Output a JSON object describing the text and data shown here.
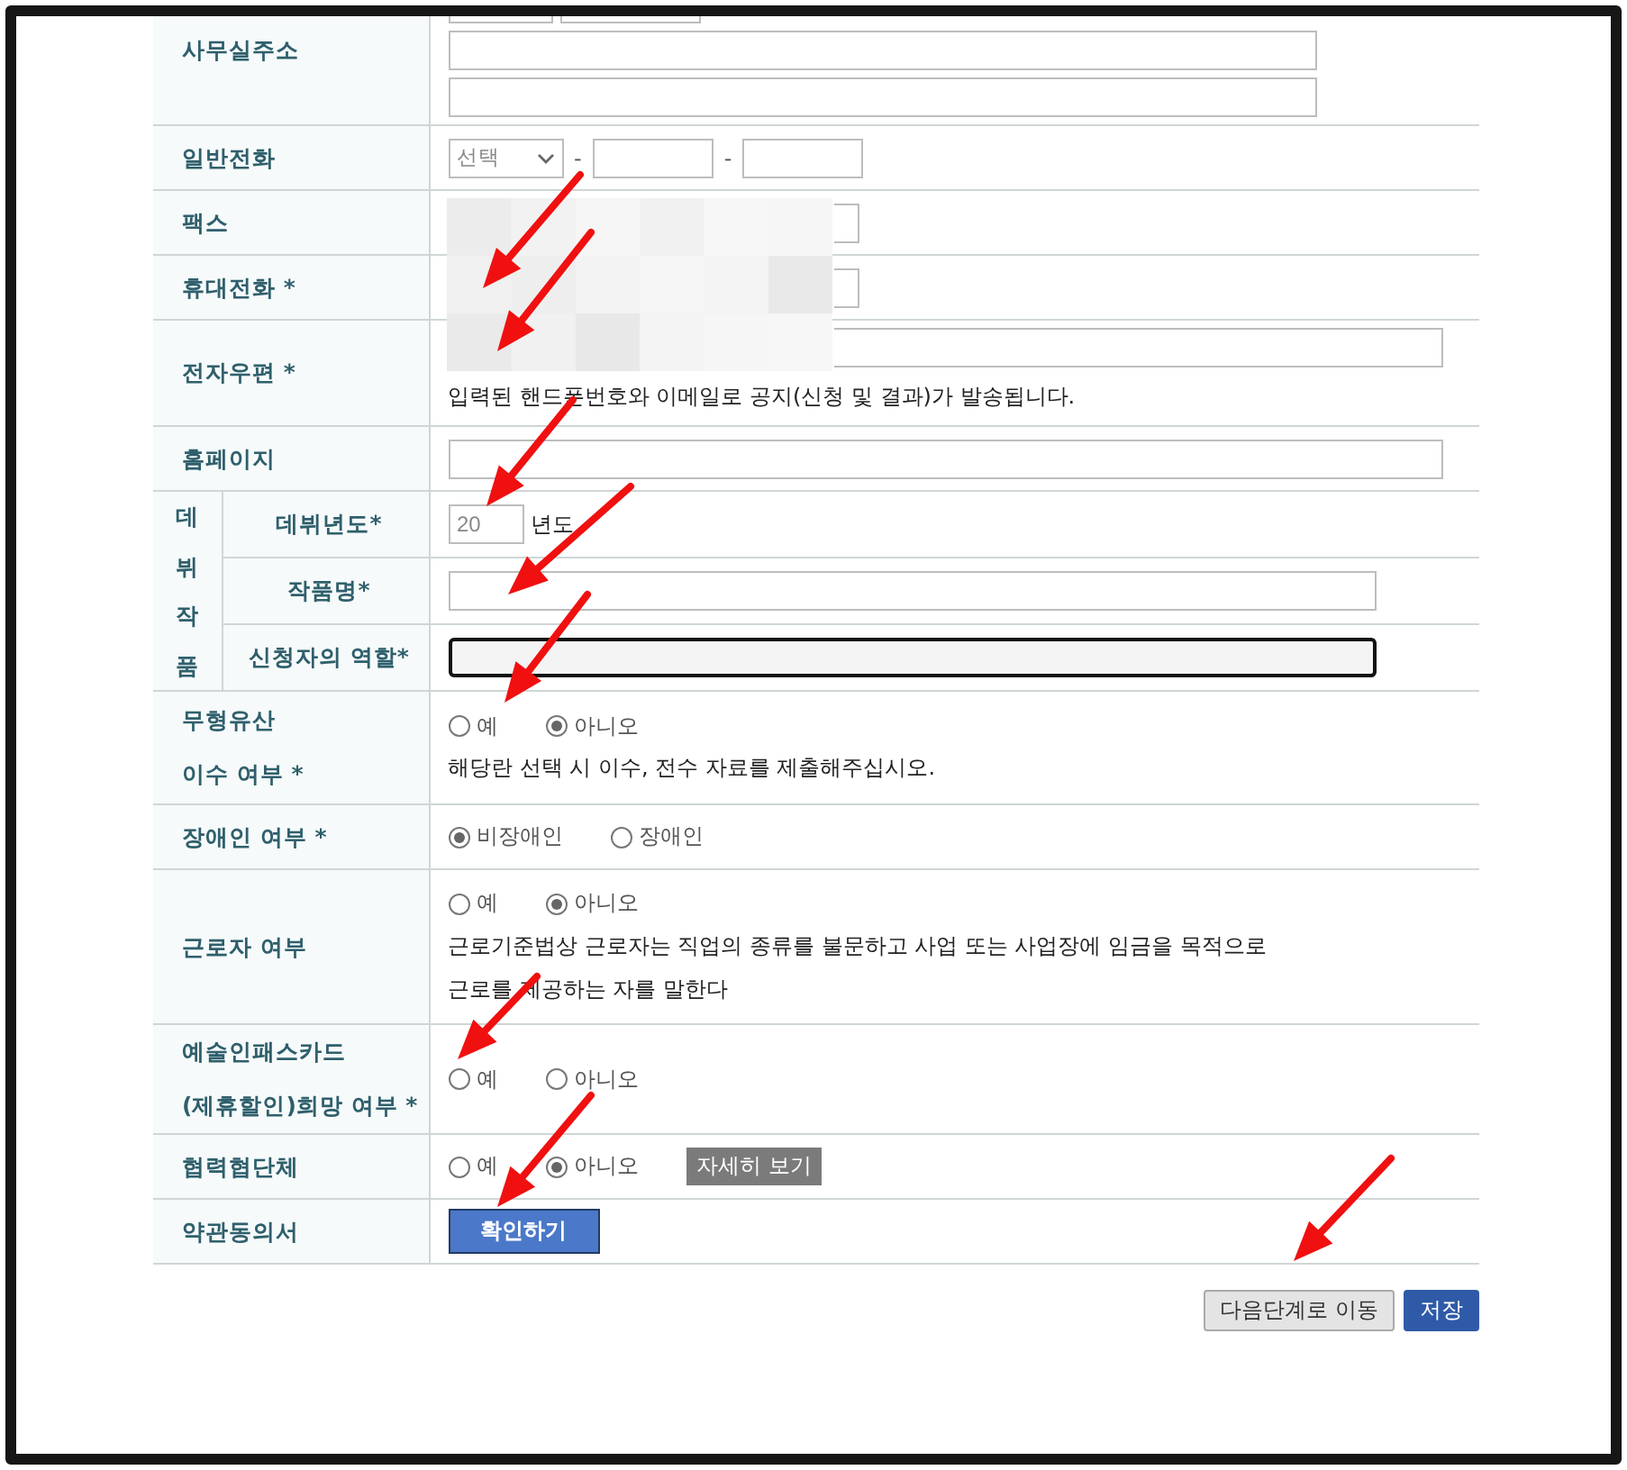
{
  "rows": [
    {
      "kind": "address",
      "label_lines": [
        "사무실주소"
      ]
    },
    {
      "kind": "phone",
      "label_lines": [
        "일반전화"
      ],
      "select": "선택",
      "separators": [
        "-",
        "-"
      ]
    },
    {
      "kind": "phone_hidden",
      "label_lines": [
        "팩스"
      ]
    },
    {
      "kind": "phone_hidden",
      "label_lines": [
        "휴대전화 *"
      ]
    },
    {
      "kind": "email",
      "label_lines": [
        "전자우편 *"
      ],
      "notes": [
        "입력된 핸드폰번호와 이메일로 공지(신청 및 결과)가 발송됩니다."
      ]
    },
    {
      "kind": "text",
      "label_lines": [
        "홈페이지"
      ]
    },
    {
      "kind": "group",
      "label": "데뷔작품",
      "children": [
        {
          "kind": "year",
          "label": "데뷔년도*",
          "value": "20",
          "unit": "년도"
        },
        {
          "kind": "text",
          "label": "작품명*",
          "focused": false
        },
        {
          "kind": "text",
          "label": "신청자의 역할*",
          "focused": true
        }
      ]
    },
    {
      "kind": "radio",
      "label_lines": [
        "무형유산",
        "이수 여부 *"
      ],
      "options": [
        {
          "label": "예",
          "selected": false
        },
        {
          "label": "아니오",
          "selected": true
        }
      ],
      "notes": [
        "해당란 선택 시 이수, 전수 자료를 제출해주십시오."
      ]
    },
    {
      "kind": "radio",
      "label_lines": [
        "장애인 여부 *"
      ],
      "options": [
        {
          "label": "비장애인",
          "selected": true
        },
        {
          "label": "장애인",
          "selected": false
        }
      ]
    },
    {
      "kind": "radio",
      "label_lines": [
        "근로자 여부"
      ],
      "options": [
        {
          "label": "예",
          "selected": false
        },
        {
          "label": "아니오",
          "selected": true
        }
      ],
      "notes": [
        "근로기준법상 근로자는 직업의 종류를 불문하고 사업 또는 사업장에 임금을 목적으로",
        "근로를 제공하는 자를 말한다"
      ]
    },
    {
      "kind": "radio",
      "label_lines": [
        "예술인패스카드",
        "(제휴할인)희망 여부 *"
      ],
      "options": [
        {
          "label": "예",
          "selected": false
        },
        {
          "label": "아니오",
          "selected": false
        }
      ]
    },
    {
      "kind": "radio",
      "label_lines": [
        "협력협단체"
      ],
      "options": [
        {
          "label": "예",
          "selected": false
        },
        {
          "label": "아니오",
          "selected": true
        }
      ],
      "detail_button": "자세히 보기"
    },
    {
      "kind": "button",
      "label_lines": [
        "약관동의서"
      ],
      "button": "확인하기"
    }
  ],
  "buttons": [
    {
      "label": "다음단계로 이동",
      "kind": "secondary"
    },
    {
      "label": "저장",
      "kind": "primary"
    }
  ]
}
